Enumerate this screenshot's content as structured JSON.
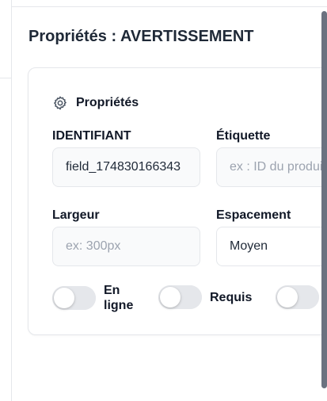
{
  "panel": {
    "title": "Propriétés : AVERTISSEMENT"
  },
  "section": {
    "title": "Propriétés",
    "icon": "gear-icon"
  },
  "fields": {
    "identifiant": {
      "label": "IDENTIFIANT",
      "value": "field_174830166343"
    },
    "etiquette": {
      "label": "Étiquette",
      "placeholder": "ex : ID du produit"
    },
    "largeur": {
      "label": "Largeur",
      "placeholder": "ex: 300px"
    },
    "espacement": {
      "label": "Espacement",
      "value": "Moyen"
    }
  },
  "toggles": {
    "en_ligne": {
      "label": "En ligne",
      "checked": false
    },
    "requis": {
      "label": "Requis",
      "checked": false
    },
    "third": {
      "checked": false
    }
  },
  "colors": {
    "toggle_off": "#e5e7eb",
    "border": "#e5e7eb",
    "input_bg": "#f9fafb",
    "scrollbar": "#6b7280"
  }
}
